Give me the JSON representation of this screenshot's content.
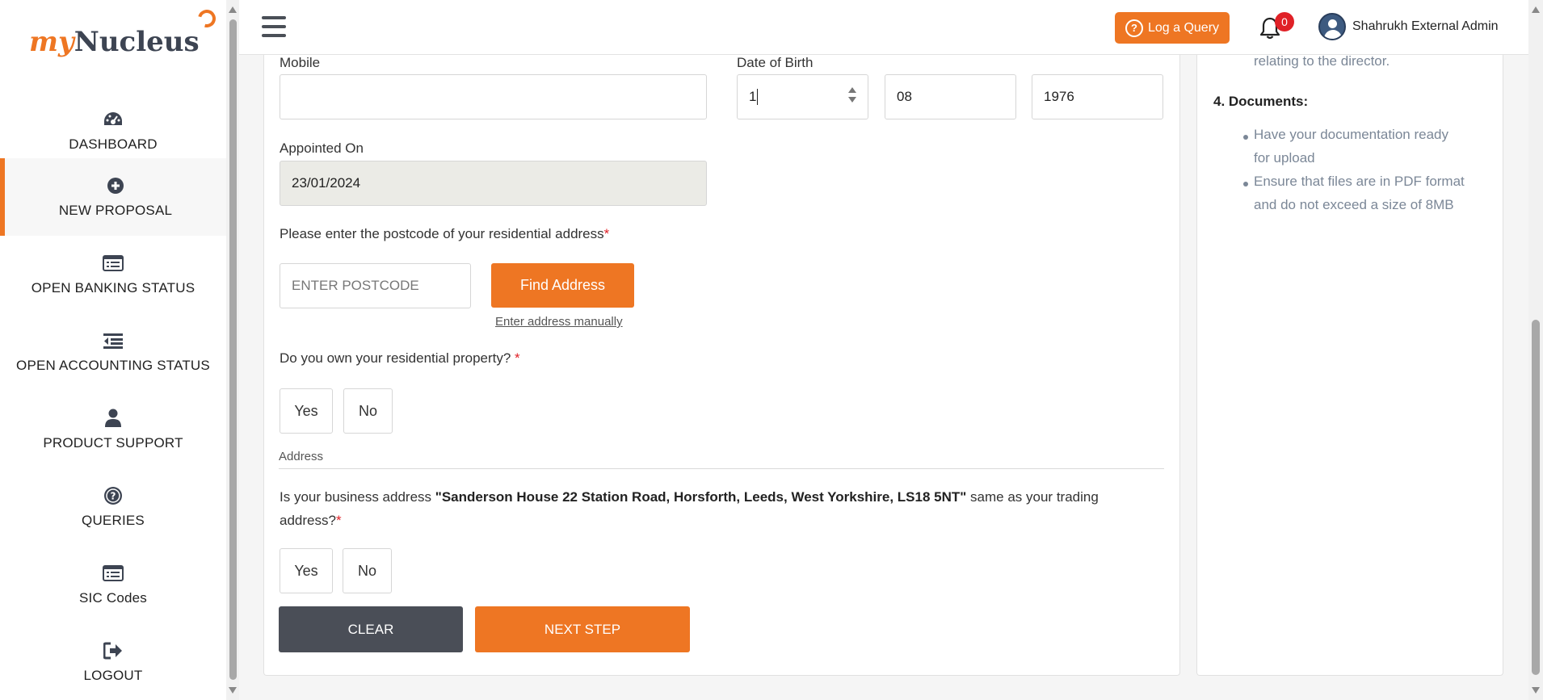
{
  "sidebar": {
    "logo_my": "my",
    "logo_nucleus": "Nucleus",
    "items": [
      {
        "label": "DASHBOARD",
        "icon": "dashboard-icon"
      },
      {
        "label": "NEW PROPOSAL",
        "icon": "plus-circle-icon"
      },
      {
        "label": "OPEN BANKING STATUS",
        "icon": "list-icon"
      },
      {
        "label": "OPEN ACCOUNTING STATUS",
        "icon": "indent-icon"
      },
      {
        "label": "PRODUCT SUPPORT",
        "icon": "user-icon"
      },
      {
        "label": "QUERIES",
        "icon": "question-circle-icon"
      },
      {
        "label": "SIC Codes",
        "icon": "list-icon"
      },
      {
        "label": "LOGOUT",
        "icon": "logout-icon"
      }
    ],
    "active_index": 1
  },
  "header": {
    "log_query_label": "Log a Query",
    "notification_count": "0",
    "user_name": "Shahrukh External Admin"
  },
  "form": {
    "mobile_label": "Mobile",
    "mobile_value": "",
    "dob_label": "Date of Birth",
    "dob_day": "1",
    "dob_month": "08",
    "dob_year": "1976",
    "appointed_label": "Appointed On",
    "appointed_value": "23/01/2024",
    "postcode_prompt": "Please enter the postcode of your residential address",
    "required_mark": "*",
    "postcode_placeholder": "ENTER POSTCODE",
    "find_address_label": "Find Address",
    "enter_manually_label": "Enter address manually",
    "own_property_question": "Do you own your residential property? ",
    "yes_label": "Yes",
    "no_label": "No",
    "address_section_label": "Address",
    "business_q_prefix": "Is your business address ",
    "business_address": "\"Sanderson House 22 Station Road, Horsforth, Leeds, West Yorkshire, LS18 5NT\"",
    "business_q_suffix_line1": " same as your trading",
    "business_q_suffix_line2": "address?",
    "clear_label": "CLEAR",
    "next_label": "NEXT STEP"
  },
  "guide": {
    "top_text": "relating to the director.",
    "section4_title": "4. Documents:",
    "bullet1_line1": "Have your documentation ready",
    "bullet1_line2": "for upload",
    "bullet2_line1": "Ensure that files are in PDF format",
    "bullet2_line2": "and do not exceed a size of 8MB"
  },
  "colors": {
    "accent": "#ee7623",
    "dark_button": "#4a4e57",
    "required": "#e02127",
    "guide_text": "#7b8797"
  }
}
